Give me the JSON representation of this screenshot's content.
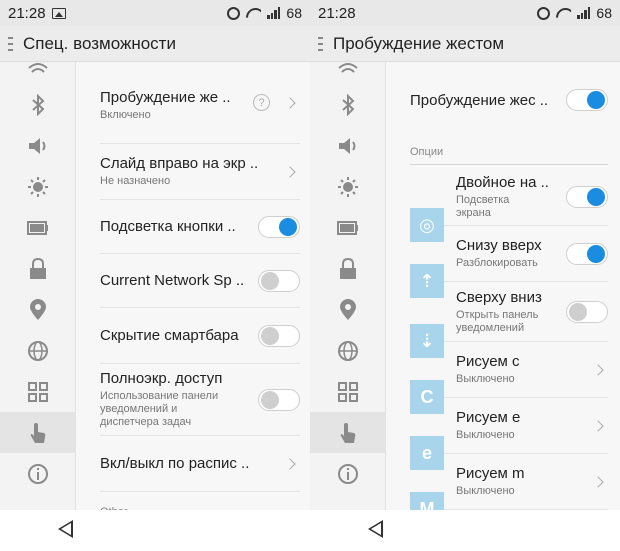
{
  "left": {
    "status": {
      "time": "21:28",
      "battery": "68"
    },
    "title": "Спец. возможности",
    "sidebar_icons": [
      "wifi-icon",
      "bluetooth-icon",
      "sound-icon",
      "brightness-icon",
      "battery-icon",
      "lock-icon",
      "location-icon",
      "globe-icon",
      "grid-icon",
      "hand-icon",
      "info-icon"
    ],
    "rows": [
      {
        "title": "Пробуждение же ..",
        "subtitle": "Включено",
        "type": "help-chevron"
      },
      {
        "title": "Слайд вправо на экр ..",
        "subtitle": "Не назначено",
        "type": "chevron"
      },
      {
        "title": "Подсветка кнопки ..",
        "type": "toggle",
        "on": true
      },
      {
        "title": "Current Network Sp ..",
        "type": "toggle",
        "on": false
      },
      {
        "title": "Скрытие смартбара",
        "type": "toggle",
        "on": false
      },
      {
        "title": "Полноэкр. доступ",
        "subtitle": "Использование панели уведомлений и диспетчера задач",
        "type": "toggle",
        "on": false
      },
      {
        "title": "Вкл/выкл по распис ..",
        "type": "chevron"
      }
    ],
    "help_glyph": "?",
    "section_other": "Other"
  },
  "right": {
    "status": {
      "time": "21:28",
      "battery": "68"
    },
    "title": "Пробуждение жестом",
    "master": {
      "title": "Пробуждение жес ..",
      "on": true
    },
    "options_label": "Опции",
    "options": [
      {
        "title": "Двойное на ..",
        "subtitle": "Подсветка экрана",
        "type": "toggle",
        "on": true,
        "icon": "double-tap-icon",
        "glyph": "◎"
      },
      {
        "title": "Снизу вверх",
        "subtitle": "Разблокировать",
        "type": "toggle",
        "on": true,
        "icon": "swipe-up-icon",
        "glyph": "⇡"
      },
      {
        "title": "Сверху вниз",
        "subtitle": "Открыть панель уведомлений",
        "type": "toggle",
        "on": false,
        "icon": "swipe-down-icon",
        "glyph": "⇣"
      },
      {
        "title": "Рисуем c",
        "subtitle": "Выключено",
        "type": "chevron",
        "icon": "draw-c-icon",
        "glyph": "C"
      },
      {
        "title": "Рисуем e",
        "subtitle": "Выключено",
        "type": "chevron",
        "icon": "draw-e-icon",
        "glyph": "e"
      },
      {
        "title": "Рисуем m",
        "subtitle": "Выключено",
        "type": "chevron",
        "icon": "draw-m-icon",
        "glyph": "M"
      }
    ]
  },
  "colors": {
    "accent": "#1a8de0",
    "icon_bg": "#a9d5ec"
  }
}
